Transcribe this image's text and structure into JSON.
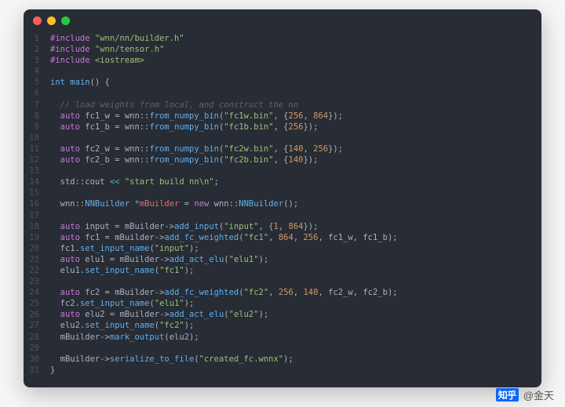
{
  "titlebar": {
    "buttons": [
      "close",
      "minimize",
      "zoom"
    ]
  },
  "attribution": {
    "brand": "知乎",
    "handle": "@金天"
  },
  "code": {
    "lines": [
      {
        "n": 1,
        "tokens": [
          [
            "kw",
            "#include"
          ],
          [
            "pun",
            " "
          ],
          [
            "str",
            "\"wnn/nn/builder.h\""
          ]
        ]
      },
      {
        "n": 2,
        "tokens": [
          [
            "kw",
            "#include"
          ],
          [
            "pun",
            " "
          ],
          [
            "str",
            "\"wnn/tensor.h\""
          ]
        ]
      },
      {
        "n": 3,
        "tokens": [
          [
            "kw",
            "#include"
          ],
          [
            "pun",
            " "
          ],
          [
            "str",
            "<iostream>"
          ]
        ]
      },
      {
        "n": 4,
        "tokens": []
      },
      {
        "n": 5,
        "tokens": [
          [
            "type",
            "int"
          ],
          [
            "pun",
            " "
          ],
          [
            "fn",
            "main"
          ],
          [
            "pun",
            "() {"
          ]
        ]
      },
      {
        "n": 6,
        "tokens": []
      },
      {
        "n": 7,
        "tokens": [
          [
            "pun",
            "  "
          ],
          [
            "cmt",
            "// load weights from local, and construct the nn"
          ]
        ]
      },
      {
        "n": 8,
        "tokens": [
          [
            "pun",
            "  "
          ],
          [
            "kw",
            "auto"
          ],
          [
            "pun",
            " fc1_w = wnn::"
          ],
          [
            "fn",
            "from_numpy_bin"
          ],
          [
            "pun",
            "("
          ],
          [
            "str",
            "\"fc1w.bin\""
          ],
          [
            "pun",
            ", {"
          ],
          [
            "num",
            "256"
          ],
          [
            "pun",
            ", "
          ],
          [
            "num",
            "864"
          ],
          [
            "pun",
            "});"
          ]
        ]
      },
      {
        "n": 9,
        "tokens": [
          [
            "pun",
            "  "
          ],
          [
            "kw",
            "auto"
          ],
          [
            "pun",
            " fc1_b = wnn::"
          ],
          [
            "fn",
            "from_numpy_bin"
          ],
          [
            "pun",
            "("
          ],
          [
            "str",
            "\"fc1b.bin\""
          ],
          [
            "pun",
            ", {"
          ],
          [
            "num",
            "256"
          ],
          [
            "pun",
            "});"
          ]
        ]
      },
      {
        "n": 10,
        "tokens": []
      },
      {
        "n": 11,
        "tokens": [
          [
            "pun",
            "  "
          ],
          [
            "kw",
            "auto"
          ],
          [
            "pun",
            " fc2_w = wnn::"
          ],
          [
            "fn",
            "from_numpy_bin"
          ],
          [
            "pun",
            "("
          ],
          [
            "str",
            "\"fc2w.bin\""
          ],
          [
            "pun",
            ", {"
          ],
          [
            "num",
            "140"
          ],
          [
            "pun",
            ", "
          ],
          [
            "num",
            "256"
          ],
          [
            "pun",
            "});"
          ]
        ]
      },
      {
        "n": 12,
        "tokens": [
          [
            "pun",
            "  "
          ],
          [
            "kw",
            "auto"
          ],
          [
            "pun",
            " fc2_b = wnn::"
          ],
          [
            "fn",
            "from_numpy_bin"
          ],
          [
            "pun",
            "("
          ],
          [
            "str",
            "\"fc2b.bin\""
          ],
          [
            "pun",
            ", {"
          ],
          [
            "num",
            "140"
          ],
          [
            "pun",
            "});"
          ]
        ]
      },
      {
        "n": 13,
        "tokens": []
      },
      {
        "n": 14,
        "tokens": [
          [
            "pun",
            "  std::cout "
          ],
          [
            "op",
            "<<"
          ],
          [
            "pun",
            " "
          ],
          [
            "str",
            "\"start build nn\\n\""
          ],
          [
            "pun",
            ";"
          ]
        ]
      },
      {
        "n": 15,
        "tokens": []
      },
      {
        "n": 16,
        "tokens": [
          [
            "pun",
            "  wnn::"
          ],
          [
            "type",
            "NNBuilder"
          ],
          [
            "pun",
            " "
          ],
          [
            "op",
            "*"
          ],
          [
            "ptr",
            "mBuilder"
          ],
          [
            "pun",
            " = "
          ],
          [
            "kw",
            "new"
          ],
          [
            "pun",
            " wnn::"
          ],
          [
            "fn",
            "NNBuilder"
          ],
          [
            "pun",
            "();"
          ]
        ]
      },
      {
        "n": 17,
        "tokens": []
      },
      {
        "n": 18,
        "tokens": [
          [
            "pun",
            "  "
          ],
          [
            "kw",
            "auto"
          ],
          [
            "pun",
            " input = mBuilder->"
          ],
          [
            "fn",
            "add_input"
          ],
          [
            "pun",
            "("
          ],
          [
            "str",
            "\"input\""
          ],
          [
            "pun",
            ", {"
          ],
          [
            "num",
            "1"
          ],
          [
            "pun",
            ", "
          ],
          [
            "num",
            "864"
          ],
          [
            "pun",
            "});"
          ]
        ]
      },
      {
        "n": 19,
        "tokens": [
          [
            "pun",
            "  "
          ],
          [
            "kw",
            "auto"
          ],
          [
            "pun",
            " fc1 = mBuilder->"
          ],
          [
            "fn",
            "add_fc_weighted"
          ],
          [
            "pun",
            "("
          ],
          [
            "str",
            "\"fc1\""
          ],
          [
            "pun",
            ", "
          ],
          [
            "num",
            "864"
          ],
          [
            "pun",
            ", "
          ],
          [
            "num",
            "256"
          ],
          [
            "pun",
            ", fc1_w, fc1_b);"
          ]
        ]
      },
      {
        "n": 20,
        "tokens": [
          [
            "pun",
            "  fc1."
          ],
          [
            "fn",
            "set_input_name"
          ],
          [
            "pun",
            "("
          ],
          [
            "str",
            "\"input\""
          ],
          [
            "pun",
            ");"
          ]
        ]
      },
      {
        "n": 21,
        "tokens": [
          [
            "pun",
            "  "
          ],
          [
            "kw",
            "auto"
          ],
          [
            "pun",
            " elu1 = mBuilder->"
          ],
          [
            "fn",
            "add_act_elu"
          ],
          [
            "pun",
            "("
          ],
          [
            "str",
            "\"elu1\""
          ],
          [
            "pun",
            ");"
          ]
        ]
      },
      {
        "n": 22,
        "tokens": [
          [
            "pun",
            "  elu1."
          ],
          [
            "fn",
            "set_input_name"
          ],
          [
            "pun",
            "("
          ],
          [
            "str",
            "\"fc1\""
          ],
          [
            "pun",
            ");"
          ]
        ]
      },
      {
        "n": 23,
        "tokens": []
      },
      {
        "n": 24,
        "tokens": [
          [
            "pun",
            "  "
          ],
          [
            "kw",
            "auto"
          ],
          [
            "pun",
            " fc2 = mBuilder->"
          ],
          [
            "fn",
            "add_fc_weighted"
          ],
          [
            "pun",
            "("
          ],
          [
            "str",
            "\"fc2\""
          ],
          [
            "pun",
            ", "
          ],
          [
            "num",
            "256"
          ],
          [
            "pun",
            ", "
          ],
          [
            "num",
            "140"
          ],
          [
            "pun",
            ", fc2_w, fc2_b);"
          ]
        ]
      },
      {
        "n": 25,
        "tokens": [
          [
            "pun",
            "  fc2."
          ],
          [
            "fn",
            "set_input_name"
          ],
          [
            "pun",
            "("
          ],
          [
            "str",
            "\"elu1\""
          ],
          [
            "pun",
            ");"
          ]
        ]
      },
      {
        "n": 26,
        "tokens": [
          [
            "pun",
            "  "
          ],
          [
            "kw",
            "auto"
          ],
          [
            "pun",
            " elu2 = mBuilder->"
          ],
          [
            "fn",
            "add_act_elu"
          ],
          [
            "pun",
            "("
          ],
          [
            "str",
            "\"elu2\""
          ],
          [
            "pun",
            ");"
          ]
        ]
      },
      {
        "n": 27,
        "tokens": [
          [
            "pun",
            "  elu2."
          ],
          [
            "fn",
            "set_input_name"
          ],
          [
            "pun",
            "("
          ],
          [
            "str",
            "\"fc2\""
          ],
          [
            "pun",
            ");"
          ]
        ]
      },
      {
        "n": 28,
        "tokens": [
          [
            "pun",
            "  mBuilder->"
          ],
          [
            "fn",
            "mark_output"
          ],
          [
            "pun",
            "(elu2);"
          ]
        ]
      },
      {
        "n": 29,
        "tokens": []
      },
      {
        "n": 30,
        "tokens": [
          [
            "pun",
            "  mBuilder->"
          ],
          [
            "fn",
            "serialize_to_file"
          ],
          [
            "pun",
            "("
          ],
          [
            "str",
            "\"created_fc.wnnx\""
          ],
          [
            "pun",
            ");"
          ]
        ]
      },
      {
        "n": 31,
        "tokens": [
          [
            "pun",
            "}"
          ]
        ]
      }
    ]
  }
}
